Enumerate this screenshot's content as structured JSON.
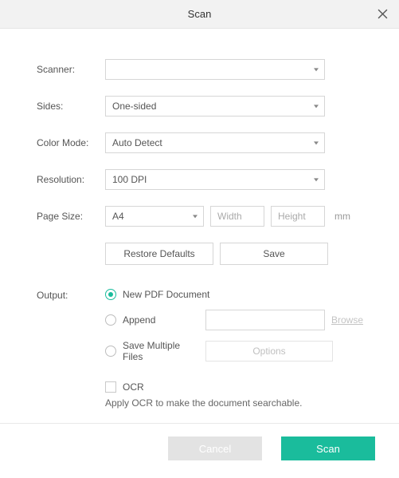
{
  "title": "Scan",
  "labels": {
    "scanner": "Scanner:",
    "sides": "Sides:",
    "color_mode": "Color Mode:",
    "resolution": "Resolution:",
    "page_size": "Page Size:",
    "output": "Output:"
  },
  "scanner": {
    "value": ""
  },
  "sides": {
    "value": "One-sided"
  },
  "color_mode": {
    "value": "Auto Detect"
  },
  "resolution": {
    "value": "100 DPI"
  },
  "page_size": {
    "value": "A4",
    "width_placeholder": "Width",
    "height_placeholder": "Height",
    "unit": "mm"
  },
  "buttons": {
    "restore": "Restore Defaults",
    "save": "Save",
    "options": "Options",
    "browse": "Browse",
    "cancel": "Cancel",
    "scan": "Scan"
  },
  "output": {
    "new_pdf": "New PDF Document",
    "append": "Append",
    "append_value": "",
    "multiple": "Save Multiple Files",
    "selected": "new_pdf"
  },
  "ocr": {
    "label": "OCR",
    "checked": false,
    "hint": "Apply OCR to make the document searchable."
  }
}
